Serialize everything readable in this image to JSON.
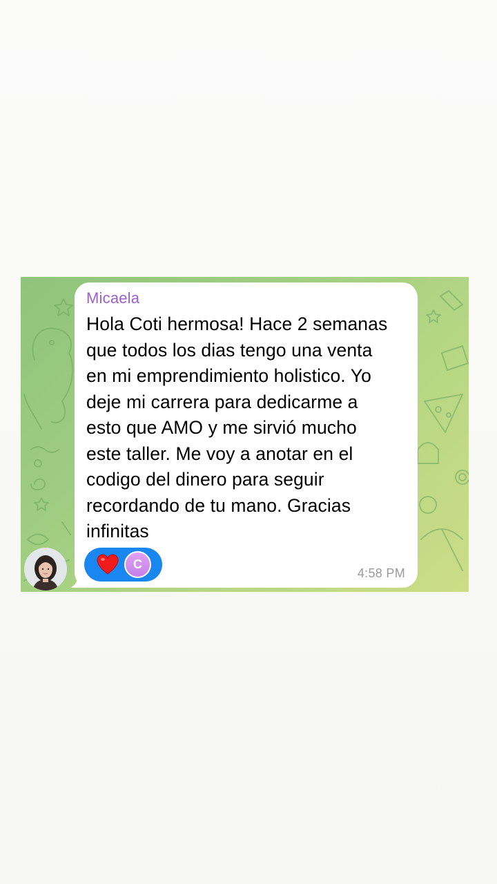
{
  "message": {
    "sender": "Micaela",
    "text": "Hola Coti hermosa! Hace 2 semanas\nque todos los dias tengo una venta\nen mi emprendimiento holistico. Yo\ndeje mi carrera para dedicarme a\nesto que AMO y me sirvió mucho\neste taller. Me voy a anotar en el\ncodigo del dinero para seguir\nrecordando de tu mano. Gracias\ninfinitas",
    "time": "4:58 PM",
    "reaction": {
      "emoji_icon": "heart-icon",
      "reactor_initial": "C",
      "pill_color": "#1a86f0",
      "reactor_color": "#d18ff0"
    },
    "sender_color": "#9a5fd0"
  },
  "background": {
    "colors": [
      "#8fc47c",
      "#cddc87"
    ]
  }
}
